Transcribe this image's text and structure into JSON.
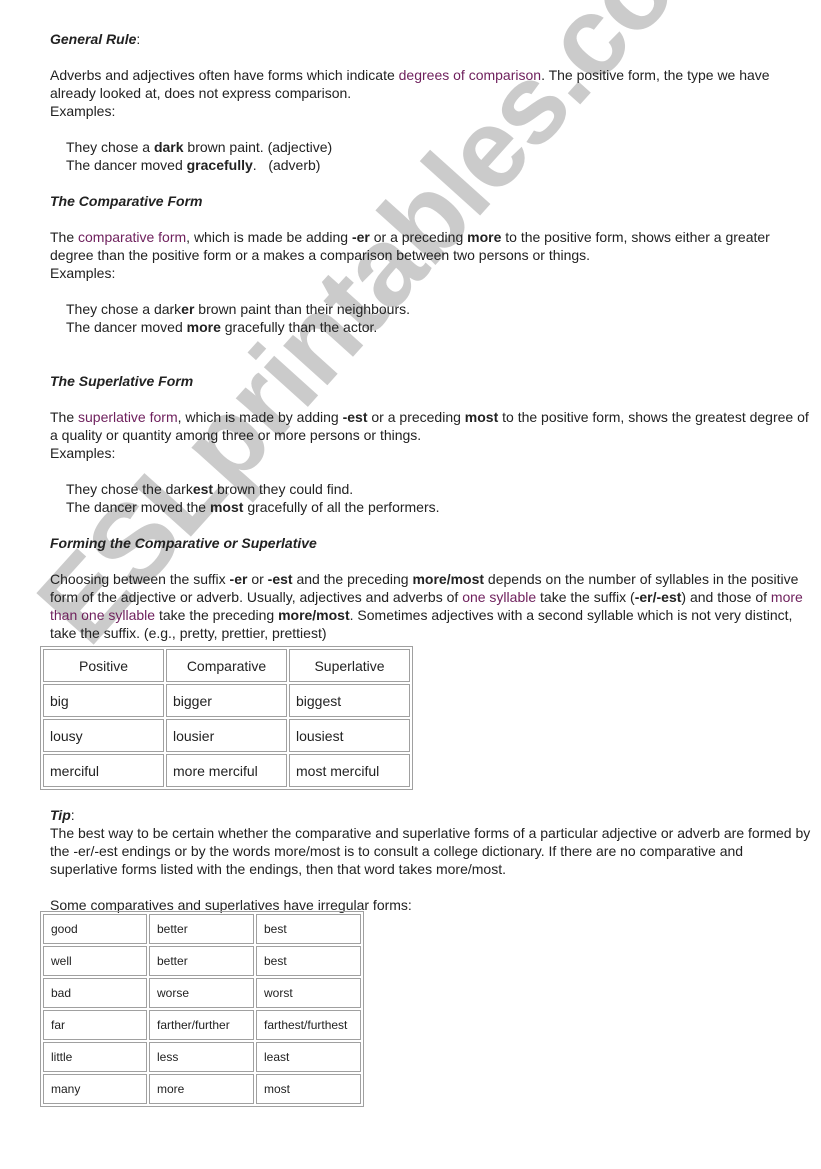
{
  "general": {
    "heading": "General Rule",
    "heading_suffix": ":",
    "p1_a": "Adverbs and adjectives often have forms which indicate ",
    "p1_hl": "degrees of comparison",
    "p1_b": ". The positive form, the type we have already looked at, does not express comparison.",
    "examples_label": "Examples:",
    "ex1_a": "They chose a ",
    "ex1_bold": "dark",
    "ex1_b": " brown paint. (adjective)",
    "ex2_a": "The dancer moved ",
    "ex2_bold": "gracefully",
    "ex2_b": ".   (adverb)"
  },
  "comparative": {
    "heading": "The Comparative Form",
    "p_a": "The ",
    "p_hl": "comparative form",
    "p_b": ", which is made be adding ",
    "p_bold1": "-er",
    "p_c": " or a preceding ",
    "p_bold2": "more",
    "p_d": " to the positive form, shows either a greater degree than the positive form or a makes a comparison between two persons or things.",
    "examples_label": "Examples:",
    "ex1_a": "They chose a dark",
    "ex1_bold": "er",
    "ex1_b": " brown paint than their neighbours.",
    "ex2_a": "The dancer moved ",
    "ex2_bold": "more",
    "ex2_b": " gracefully than the actor."
  },
  "superlative": {
    "heading": "The Superlative Form",
    "p_a": "The ",
    "p_hl": "superlative form",
    "p_b": ", which is made by adding ",
    "p_bold1": "-est",
    "p_c": " or a preceding ",
    "p_bold2": "most",
    "p_d": " to the positive form, shows the greatest degree of a quality or quantity among three or more persons or things.",
    "examples_label": "Examples:",
    "ex1_a": "They chose the dark",
    "ex1_bold": "est",
    "ex1_b": " brown they could find.",
    "ex2_a": "The dancer moved the ",
    "ex2_bold": "most",
    "ex2_b": " gracefully of all the performers."
  },
  "forming": {
    "heading": "Forming the Comparative or Superlative",
    "p_a": "Choosing between the suffix ",
    "p_bold1": "-er",
    "p_b": " or ",
    "p_bold2": "-est",
    "p_c": " and the preceding ",
    "p_bold3": "more/most",
    "p_d": " depends on the number of syllables in the positive form of the adjective or adverb. Usually, adjectives and adverbs of ",
    "p_hl1": "one syllable",
    "p_e": " take the suffix (",
    "p_bold4": "-er/-est",
    "p_f": ") and those of ",
    "p_hl2": "more than one syllable",
    "p_g": " take the preceding ",
    "p_bold5": "more/most",
    "p_h": ". Sometimes adjectives with a second syllable which is not very distinct, take the suffix. (e.g., pretty, prettier, prettiest)"
  },
  "forms_table": {
    "headers": [
      "Positive",
      "Comparative",
      "Superlative"
    ],
    "rows": [
      [
        "big",
        "bigger",
        "biggest"
      ],
      [
        "lousy",
        "lousier",
        "lousiest"
      ],
      [
        "merciful",
        "more merciful",
        "most merciful"
      ]
    ]
  },
  "tip": {
    "heading": "Tip",
    "heading_suffix": ":",
    "text": "The best way to be certain whether the comparative and superlative forms of a particular adjective or adverb are formed by the -er/-est endings or by the words more/most is to consult a college dictionary. If there are no comparative and superlative forms listed with the endings, then that word takes more/most.",
    "irregular_intro": "Some comparatives and superlatives have irregular forms:"
  },
  "irregular_table": {
    "rows": [
      [
        "good",
        "better",
        "best"
      ],
      [
        "well",
        "better",
        "best"
      ],
      [
        "bad",
        "worse",
        "worst"
      ],
      [
        "far",
        "farther/further",
        "farthest/furthest"
      ],
      [
        "little",
        "less",
        "least"
      ],
      [
        "many",
        "more",
        "most"
      ]
    ]
  },
  "watermark": "ESLprintables.com"
}
